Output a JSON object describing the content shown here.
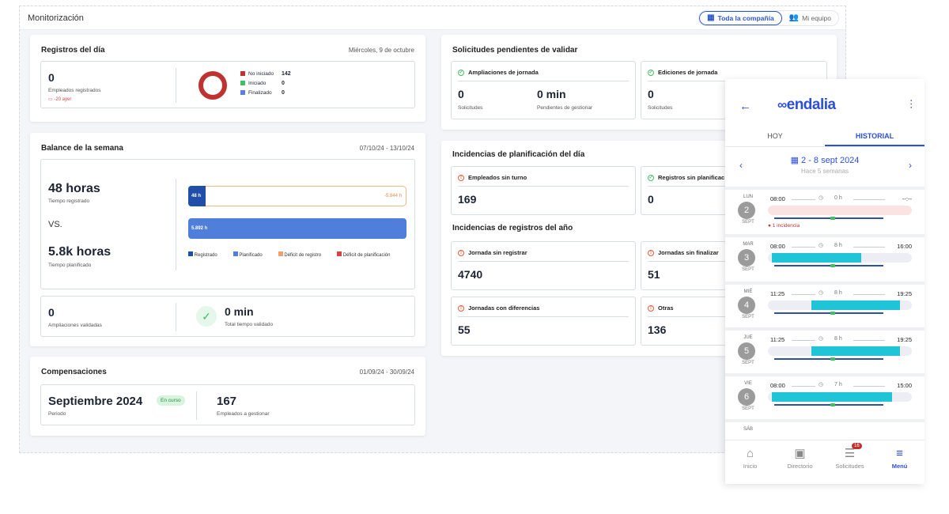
{
  "window": {
    "title": "Monitorización",
    "scope_options": [
      "Toda la compañía",
      "Mi equipo"
    ]
  },
  "registros_dia": {
    "title": "Registros del día",
    "date": "Miércoles, 9 de octubre",
    "count": "0",
    "count_label": "Empleados registrados",
    "delta": "-20 ayer",
    "legend": [
      {
        "label": "No iniciado",
        "value": "142",
        "color": "#c0322f"
      },
      {
        "label": "Iniciado",
        "value": "0",
        "color": "#3fbf5f"
      },
      {
        "label": "Finalizado",
        "value": "0",
        "color": "#5b7fd6"
      }
    ]
  },
  "balance": {
    "title": "Balance de la semana",
    "date_range": "07/10/24 - 13/10/24",
    "registered": "48 horas",
    "registered_label": "Tiempo registrado",
    "vs": "VS.",
    "planned": "5.8k horas",
    "planned_label": "Tiempo planificado",
    "bar_registered_label": "48 h",
    "bar_deficit_label": "-5.844 h",
    "bar_planned_label": "5.892 h",
    "chart_data": {
      "type": "bar",
      "series": [
        {
          "name": "Registrado",
          "values": [
            48
          ]
        },
        {
          "name": "Planificado",
          "values": [
            5892
          ]
        },
        {
          "name": "Déficit de registro",
          "values": [
            -5844
          ]
        },
        {
          "name": "Déficit de planificación",
          "values": [
            0
          ]
        }
      ]
    },
    "legend": [
      {
        "label": "Registrado",
        "color": "#1f4fa8"
      },
      {
        "label": "Planificado",
        "color": "#4f7fdb"
      },
      {
        "label": "Déficit de registro",
        "color": "#f0a070"
      },
      {
        "label": "Déficit de planificación",
        "color": "#d64545"
      }
    ],
    "ampliaciones": "0",
    "ampliaciones_label": "Ampliaciones validadas",
    "validated_time": "0 min",
    "validated_label": "Total tiempo validado"
  },
  "compensaciones": {
    "title": "Compensaciones",
    "date_range": "01/09/24 - 30/09/24",
    "period": "Septiembre 2024",
    "period_label": "Periodo",
    "badge": "En curso",
    "employees": "167",
    "employees_label": "Empleados a gestionar"
  },
  "solicitudes": {
    "title": "Solicitudes pendientes de validar",
    "ampliaciones": {
      "title": "Ampliaciones de jornada",
      "count": "0",
      "count_label": "Solicitudes",
      "pending": "0 min",
      "pending_label": "Pendientes de gestionar"
    },
    "ediciones": {
      "title": "Ediciones de jornada",
      "count": "0",
      "count_label": "Solicitudes"
    }
  },
  "incidencias_plan": {
    "title": "Incidencias de planificación del día",
    "items": [
      {
        "title": "Empleados sin turno",
        "value": "169"
      },
      {
        "title": "Registros sin planificac",
        "value": "0"
      }
    ]
  },
  "incidencias_reg": {
    "title": "Incidencias de registros del año",
    "items": [
      {
        "title": "Jornada sin registrar",
        "value": "4740"
      },
      {
        "title": "Jornadas sin finalizar",
        "value": "51"
      },
      {
        "title": "Jornadas con diferencias",
        "value": "55"
      },
      {
        "title": "Otras",
        "value": "136"
      }
    ]
  },
  "mobile": {
    "logo": "endalia",
    "tabs": [
      "HOY",
      "HISTORIAL"
    ],
    "week": "2 - 8 sept 2024",
    "week_sub": "Hace 5 semanas",
    "days": [
      {
        "dow": "LUN",
        "num": "2",
        "mon": "SEPT",
        "start": "08:00",
        "hours": "0 h",
        "end": "--:--",
        "incident": "1 incidencia",
        "fill_from": 0,
        "fill_to": 0
      },
      {
        "dow": "MAR",
        "num": "3",
        "mon": "SEPT",
        "start": "08:00",
        "hours": "8 h",
        "end": "16:00",
        "incident": "",
        "fill_from": 0.03,
        "fill_to": 0.65
      },
      {
        "dow": "MIÉ",
        "num": "4",
        "mon": "SEPT",
        "start": "11:25",
        "hours": "8 h",
        "end": "19:25",
        "incident": "",
        "fill_from": 0.3,
        "fill_to": 0.92
      },
      {
        "dow": "JUE",
        "num": "5",
        "mon": "SEPT",
        "start": "11:25",
        "hours": "8 h",
        "end": "19:25",
        "incident": "",
        "fill_from": 0.3,
        "fill_to": 0.92
      },
      {
        "dow": "VIE",
        "num": "6",
        "mon": "SEPT",
        "start": "08:00",
        "hours": "7 h",
        "end": "15:00",
        "incident": "",
        "fill_from": 0.03,
        "fill_to": 0.86
      },
      {
        "dow": "SÁB",
        "num": "",
        "mon": "",
        "start": "",
        "hours": "",
        "end": "",
        "incident": "",
        "fill_from": 0,
        "fill_to": 0
      }
    ],
    "nav": [
      "Inicio",
      "Directorio",
      "Solicitudes",
      "Menú"
    ],
    "badge_count": "16"
  }
}
